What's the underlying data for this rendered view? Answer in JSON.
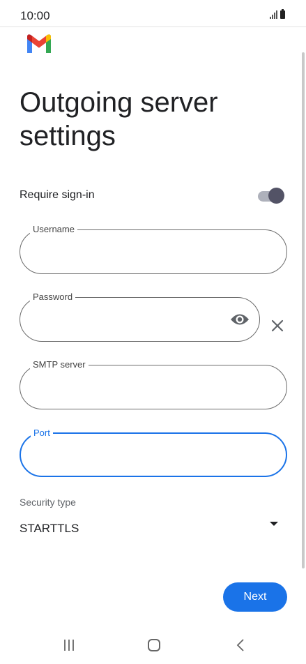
{
  "status_bar": {
    "time": "10:00"
  },
  "app": {
    "icon": "gmail-logo",
    "brand_colors": [
      "#4285f4",
      "#ea4335",
      "#fbbc04",
      "#34a853",
      "#c5221f"
    ]
  },
  "page": {
    "title": "Outgoing server settings"
  },
  "require_signin": {
    "label": "Require sign-in",
    "enabled": true
  },
  "fields": {
    "username": {
      "label": "Username",
      "value": ""
    },
    "password": {
      "label": "Password",
      "value": ""
    },
    "smtp_server": {
      "label": "SMTP server",
      "value": ""
    },
    "port": {
      "label": "Port",
      "value": ""
    }
  },
  "security": {
    "label": "Security type",
    "value": "STARTTLS"
  },
  "actions": {
    "next_label": "Next"
  },
  "colors": {
    "accent": "#1a73e8",
    "toggle_thumb": "#535366"
  }
}
